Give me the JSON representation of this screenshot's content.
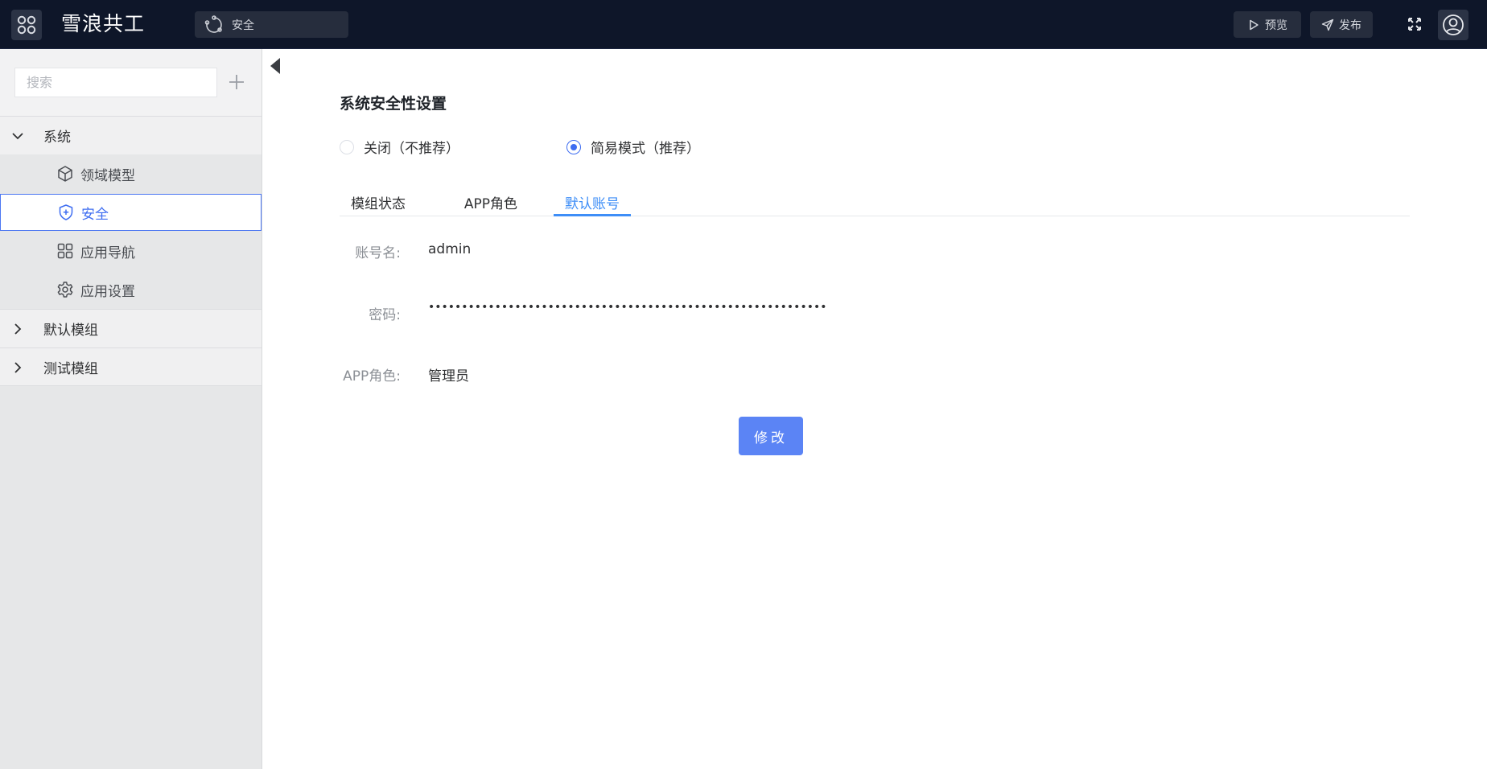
{
  "header": {
    "app_title": "雪浪共工",
    "breadcrumb": "安全",
    "preview_label": "预览",
    "publish_label": "发布"
  },
  "sidebar": {
    "search_placeholder": "搜索",
    "groups": [
      {
        "label": "系统",
        "expanded": true,
        "children": [
          {
            "label": "领域模型",
            "icon": "cube-icon"
          },
          {
            "label": "安全",
            "icon": "shield-plus-icon",
            "active": true
          },
          {
            "label": "应用导航",
            "icon": "grid-icon"
          },
          {
            "label": "应用设置",
            "icon": "gear-icon"
          }
        ]
      },
      {
        "label": "默认模组",
        "expanded": false
      },
      {
        "label": "测试模组",
        "expanded": false
      }
    ]
  },
  "main": {
    "title": "系统安全性设置",
    "radio_options": [
      {
        "label": "关闭（不推荐）",
        "checked": false
      },
      {
        "label": "简易模式（推荐）",
        "checked": true
      }
    ],
    "tabs": [
      {
        "label": "模组状态",
        "active": false
      },
      {
        "label": "APP角色",
        "active": false
      },
      {
        "label": "默认账号",
        "active": true
      }
    ],
    "form": {
      "account_label": "账号名:",
      "account_value": "admin",
      "password_label": "密码:",
      "password_value": "••••••••••••••••••••••••••••••••••••••••••••••••••••••••••••",
      "role_label": "APP角色:",
      "role_value": "管理员"
    },
    "modify_button": "修改"
  },
  "colors": {
    "header_bg": "#0e1629",
    "accent": "#3e6df1",
    "tab_active": "#3e8ef7",
    "button_bg": "#5b84f5",
    "sidebar_bg": "#e6e7e8"
  }
}
